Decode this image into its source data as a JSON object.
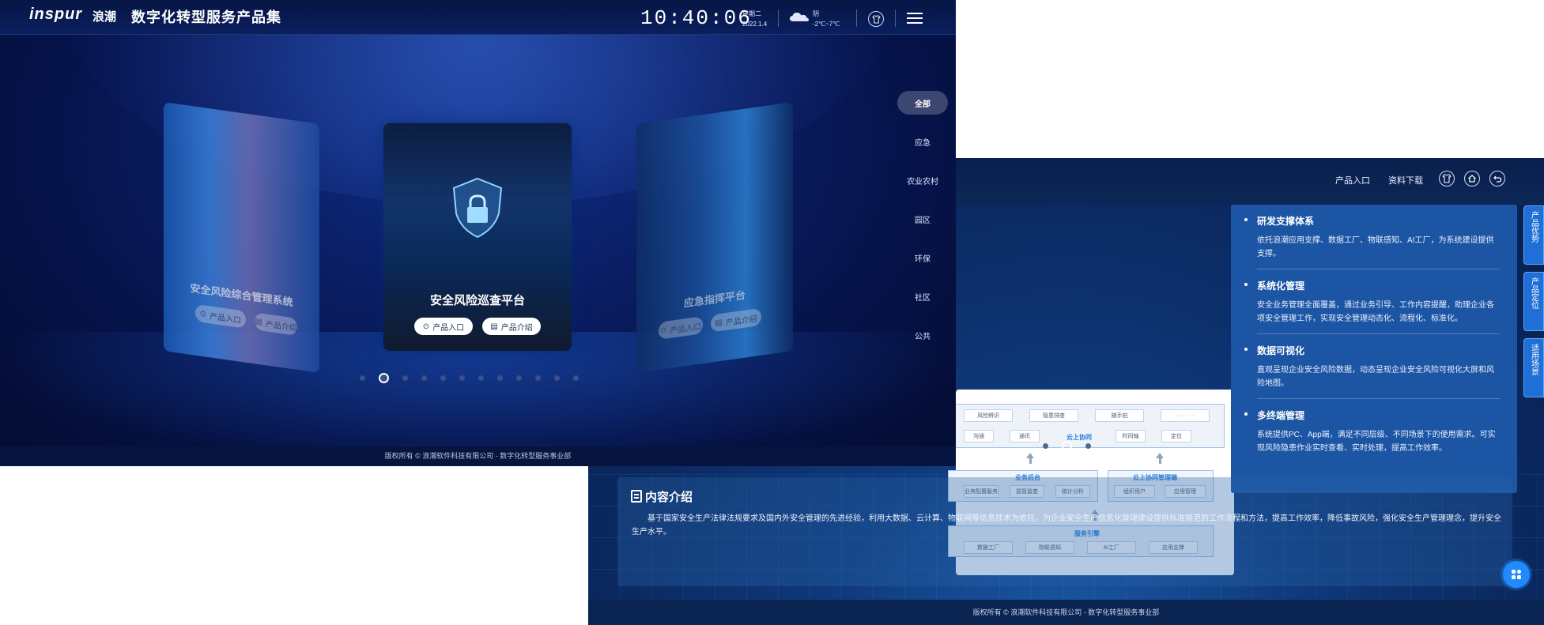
{
  "screen1": {
    "brand": {
      "logo": "inspur",
      "logo_cn": "浪潮"
    },
    "title": "数字化转型服务产品集",
    "clock": "10:40:06",
    "weekday": "星期二",
    "date": "2022.1.4",
    "weather": "阴",
    "temperature": "-2℃~7℃",
    "categories": [
      {
        "label": "全部",
        "active": true
      },
      {
        "label": "应急"
      },
      {
        "label": "农业农村"
      },
      {
        "label": "园区"
      },
      {
        "label": "环保"
      },
      {
        "label": "社区"
      },
      {
        "label": "公共"
      }
    ],
    "cards": {
      "left": {
        "title": "安全风险综合管理系统",
        "entry": "产品入口",
        "intro": "产品介绍"
      },
      "center": {
        "title": "安全风险巡查平台",
        "entry": "产品入口",
        "intro": "产品介绍"
      },
      "right": {
        "title": "应急指挥平台",
        "entry": "产品入口",
        "intro": "产品介绍"
      }
    },
    "carousel": {
      "count": 12,
      "active_index": 1
    },
    "footer": "版权所有 © 浪潮软件科技有限公司 - 数字化转型服务事业部"
  },
  "screen2": {
    "nav": {
      "product_entry": "产品入口",
      "download": "资料下载"
    },
    "diagram": {
      "row1": [
        "风险辨识",
        "隐患排查",
        "随手拍",
        "· · · · · ·"
      ],
      "row2": [
        "沟通",
        "通讯",
        "云上协同",
        "时间轴",
        "定位"
      ],
      "backend_title": "业务后台",
      "backend_items": [
        "业务配置服务",
        "监管监查",
        "统计分析"
      ],
      "cloud_title": "云上协同管理端",
      "cloud_items": [
        "组织用户",
        "应用管理"
      ],
      "engine_title": "服务引擎",
      "engine_items": [
        "数据工厂",
        "物联感知",
        "AI工厂",
        "应用支撑"
      ]
    },
    "carousel": {
      "count": 3,
      "active_index": 1
    },
    "features": [
      {
        "title": "研发支撑体系",
        "desc": "依托浪潮应用支撑、数据工厂、物联感知、AI工厂，为系统建设提供支撑。"
      },
      {
        "title": "系统化管理",
        "desc": "安全业务管理全面覆盖，通过业务引导、工作内容提醒，助理企业各项安全管理工作，实现安全管理动态化、流程化、标准化。"
      },
      {
        "title": "数据可视化",
        "desc": "直观呈现企业安全风险数据，动态呈现企业安全风险可视化大屏和风险地图。"
      },
      {
        "title": "多终端管理",
        "desc": "系统提供PC、App端，满足不同层级、不同场景下的使用需求。可实现风险隐患作业实时查看、实时处理，提高工作效率。"
      }
    ],
    "side_tabs": [
      "产品优势",
      "产品定位",
      "适用场景"
    ],
    "intro": {
      "title": "内容介绍",
      "body": "基于国家安全生产法律法规要求及国内外安全管理的先进经验，利用大数据、云计算、物联网等信息技术为依托，为企业安全生产信息化管理建设提供标准规范的工作流程和方法，提高工作效率，降低事故风险，强化安全生产管理理念，提升安全生产水平。"
    },
    "footer": "版权所有 © 浪潮软件科技有限公司 - 数字化转型服务事业部"
  }
}
